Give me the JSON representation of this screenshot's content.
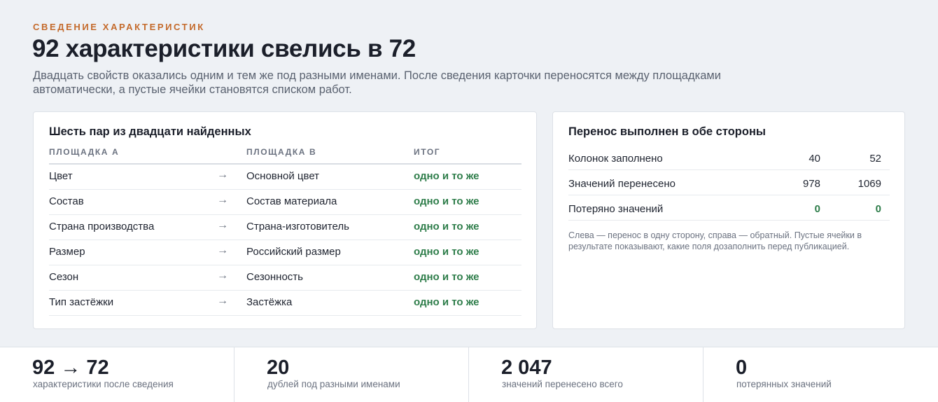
{
  "header": {
    "eyebrow": "СВЕДЕНИЕ ХАРАКТЕРИСТИК",
    "title": "92 характеристики свелись в 72",
    "lede": "Двадцать свойств оказались одним и тем же под разными именами. После сведения карточки переносятся между площадками автоматически, а пустые ячейки становятся списком работ."
  },
  "pairs": {
    "title": "Шесть пар из двадцати найденных",
    "columns": [
      "ПЛОЩАДКА А",
      "ПЛОЩАДКА В",
      "ИТОГ"
    ],
    "arrow": "→",
    "rows": [
      {
        "a": "Цвет",
        "b": "Основной цвет",
        "result": "одно и то же"
      },
      {
        "a": "Состав",
        "b": "Состав материала",
        "result": "одно и то же"
      },
      {
        "a": "Страна производства",
        "b": "Страна-изготовитель",
        "result": "одно и то же"
      },
      {
        "a": "Размер",
        "b": "Российский размер",
        "result": "одно и то же"
      },
      {
        "a": "Сезон",
        "b": "Сезонность",
        "result": "одно и то же"
      },
      {
        "a": "Тип застёжки",
        "b": "Застёжка",
        "result": "одно и то же"
      }
    ]
  },
  "transfer": {
    "title": "Перенос выполнен в обе стороны",
    "rows": [
      {
        "label": "Колонок заполнено",
        "left": "40",
        "right": "52"
      },
      {
        "label": "Значений перенесено",
        "left": "978",
        "right": "1069"
      },
      {
        "label": "Потеряно значений",
        "left": "0",
        "right": "0"
      }
    ],
    "note": "Слева — перенос в одну сторону, справа — обратный. Пустые ячейки в результате показывают, какие поля дозаполнить перед публикацией."
  },
  "stats": [
    {
      "value": "92 → 72",
      "label": "характеристики после сведения"
    },
    {
      "value": "20",
      "label": "дублей под разными именами"
    },
    {
      "value": "2 047",
      "label": "значений перенесено всего"
    },
    {
      "value": "0",
      "label": "потерянных значений"
    }
  ],
  "colors": {
    "accent": "#c46a2b",
    "success": "#2e7d4a",
    "background": "#eef1f5"
  }
}
